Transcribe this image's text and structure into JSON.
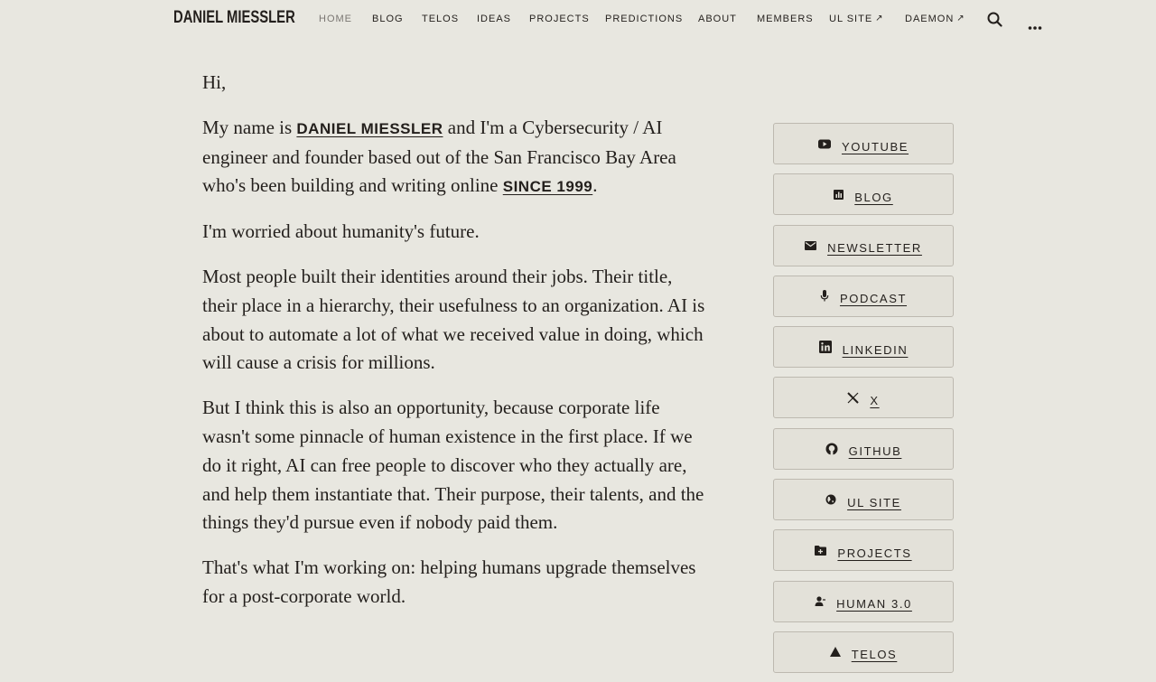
{
  "nav": {
    "brand": "DANIEL MIESSLER",
    "items": [
      {
        "label": "HOME",
        "active": true,
        "external": false
      },
      {
        "label": "BLOG",
        "active": false,
        "external": false
      },
      {
        "label": "TELOS",
        "active": false,
        "external": false
      },
      {
        "label": "IDEAS",
        "active": false,
        "external": false
      },
      {
        "label": "PROJECTS",
        "active": false,
        "external": false
      },
      {
        "label": "PREDICTIONS",
        "active": false,
        "external": false
      },
      {
        "label": "ABOUT",
        "active": false,
        "external": false
      },
      {
        "label": "MEMBERS",
        "active": false,
        "external": false
      },
      {
        "label": "UL SITE",
        "active": false,
        "external": true
      },
      {
        "label": "DAEMON",
        "active": false,
        "external": true
      }
    ],
    "external_glyph": "↗",
    "icons": [
      "search-icon",
      "more-icon"
    ]
  },
  "content": {
    "greeting": "Hi,",
    "intro_1": "My name is ",
    "intro_name": "DANIEL MIESSLER",
    "intro_2": " and I'm a Cybersecurity / AI engineer and founder based out of the San Francisco Bay Area who's been building and writing online ",
    "intro_since": "SINCE 1999",
    "intro_3": ".",
    "p2": "I'm worried about humanity's future.",
    "p3": "Most people built their identities around their jobs. Their title, their place in a hierarchy, their usefulness to an organization. AI is about to automate a lot of what we received value in doing, which will cause a crisis for millions.",
    "p4": "But I think this is also an opportunity, because corporate life wasn't some pinnacle of human existence in the first place. If we do it right, AI can free people to discover who they actually are, and help them instantiate that. Their purpose, their talents, and the things they'd pursue even if nobody paid them.",
    "p5": "That's what I'm working on: helping humans upgrade themselves for a post-corporate world."
  },
  "sidebar": {
    "buttons": [
      {
        "label": "YOUTUBE",
        "icon": "youtube-icon"
      },
      {
        "label": "BLOG",
        "icon": "blog-icon"
      },
      {
        "label": "NEWSLETTER",
        "icon": "mail-icon"
      },
      {
        "label": "PODCAST",
        "icon": "microphone-icon"
      },
      {
        "label": "LINKEDIN",
        "icon": "linkedin-icon"
      },
      {
        "label": "X",
        "icon": "x-icon"
      },
      {
        "label": "GITHUB",
        "icon": "github-icon"
      },
      {
        "label": "UL SITE",
        "icon": "globe-icon"
      },
      {
        "label": "PROJECTS",
        "icon": "folder-icon"
      },
      {
        "label": "HUMAN 3.0",
        "icon": "person-icon"
      },
      {
        "label": "TELOS",
        "icon": "triangle-icon"
      }
    ]
  },
  "colors": {
    "background": "#e8e7e0",
    "text": "#231f1c",
    "nav_active": "#7a7672",
    "button_bg": "#e3e1d9",
    "button_border": "#bdb9b0"
  }
}
